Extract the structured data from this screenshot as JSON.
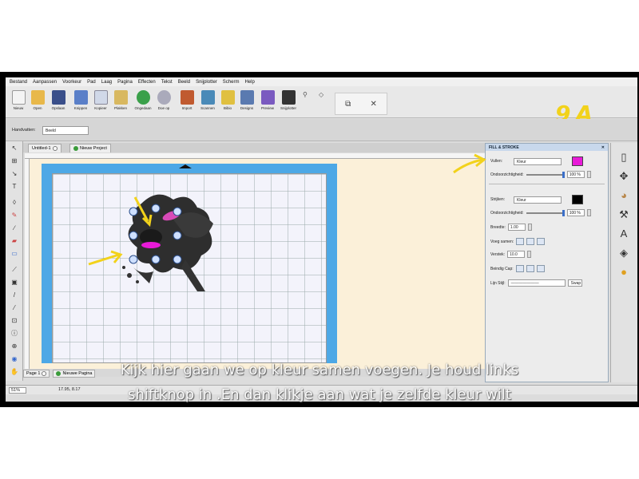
{
  "menu": [
    "Bestand",
    "Aanpassen",
    "Voorkeur",
    "Pad",
    "Laag",
    "Pagina",
    "Effecten",
    "Tekst",
    "Beeld",
    "Snijplotter",
    "Scherm",
    "Help"
  ],
  "toolbar": [
    {
      "label": "Nieuw",
      "color": "#f4f4f4"
    },
    {
      "label": "Open",
      "color": "#e8b84a"
    },
    {
      "label": "Opslaan",
      "color": "#3a4f8a"
    },
    {
      "label": "Knippen",
      "color": "#5a7fc8"
    },
    {
      "label": "Kopieer",
      "color": "#d0d8e8"
    },
    {
      "label": "Plakken",
      "color": "#d8b860"
    },
    {
      "label": "Ongedaan",
      "color": "#3aa04a"
    },
    {
      "label": "Doe op",
      "color": "#9aa"
    },
    {
      "label": "Import",
      "color": "#c05a30"
    },
    {
      "label": "Scannen",
      "color": "#4a8ab8"
    },
    {
      "label": "Bibio",
      "color": "#e0c040"
    },
    {
      "label": "Designs",
      "color": "#5a7ab0"
    },
    {
      "label": "Preview",
      "color": "#7a5ac0"
    },
    {
      "label": "Snijplotter",
      "color": "#333"
    }
  ],
  "window_controls": {
    "restore": "⧉",
    "close": "✕"
  },
  "annotation_text": "9A",
  "props": {
    "label": "Handvatten:",
    "value": "Beeld"
  },
  "tabs": [
    "Untitled-1",
    "Nieuw Project"
  ],
  "page_tabs": [
    "Page 1",
    "Nieuwe Pagina"
  ],
  "status": {
    "zoom": "51%",
    "coords": "17.95, 8.17"
  },
  "panel": {
    "title": "FILL & STROKE",
    "fill_label": "Vullen:",
    "fill_value": "Kleur",
    "fill_color": "#e81ad8",
    "opacity_label": "Ondoorzichtigheid:",
    "opacity_value": "100 %",
    "stroke_label": "Strijken:",
    "stroke_value": "Kleur",
    "stroke_color": "#000000",
    "stroke_opacity_label": "Ondoorzichtigheid:",
    "stroke_opacity_value": "100 %",
    "width_label": "Breedte:",
    "width_value": "1.00",
    "join_label": "Voeg samen:",
    "miter_label": "Verstek:",
    "miter_value": "10.0",
    "cap_label": "Beindig Cap:",
    "line_style_label": "Lijn Stijl:",
    "swap_label": "Swap"
  },
  "caption": {
    "line1": "Kijk hier gaan we op kleur samen voegen. Je houd links",
    "line2": "shiftknop in .En dan klikje aan wat je zelfde kleur wilt"
  }
}
